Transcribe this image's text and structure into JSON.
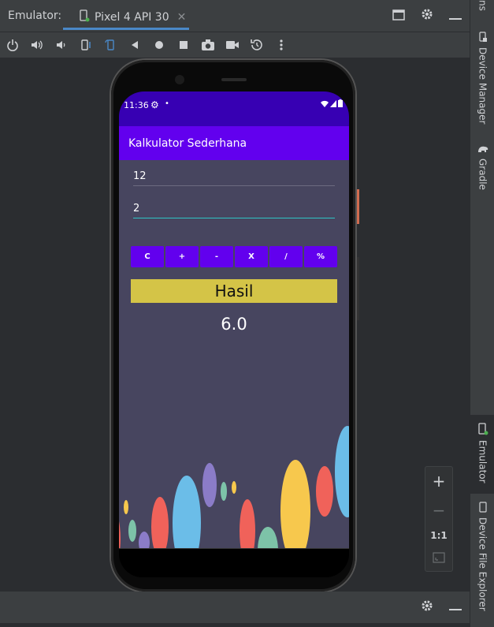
{
  "ide": {
    "tool_window_title": "Emulator:",
    "tab_label": "Pixel 4 API 30",
    "tab_close": "✕"
  },
  "toolbar": {
    "buttons": [
      "power-icon",
      "volume-up-icon",
      "volume-down-icon",
      "rotate-left-icon",
      "rotate-right-icon",
      "back-icon",
      "home-icon",
      "overview-icon",
      "screenshot-icon",
      "screen-record-icon",
      "snapshot-icon",
      "more-icon"
    ]
  },
  "side_panel": {
    "top_cut_label": "ns",
    "device_manager": "Device Manager",
    "gradle": "Gradle",
    "emulator": "Emulator",
    "device_file_explorer": "Device File Explorer"
  },
  "zoom": {
    "zoom_in": "+",
    "zoom_out": "−",
    "actual_size": "1:1"
  },
  "device": {
    "status": {
      "time": "11:36",
      "gear": "⚙",
      "dot": "•"
    },
    "app_title": "Kalkulator Sederhana",
    "input1_value": "12",
    "input2_value": "2",
    "op_buttons": [
      "C",
      "+",
      "-",
      "X",
      "/",
      "%"
    ],
    "hasil_label": "Hasil",
    "result_value": "6.0"
  },
  "colors": {
    "status_bar": "#3700b3",
    "app_bar": "#6200ee",
    "content_bg": "#47455f",
    "hasil_bg": "#d4c447",
    "input_focus": "#2ec4c4"
  }
}
